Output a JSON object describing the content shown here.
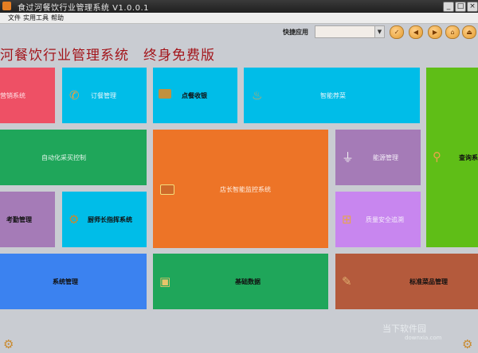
{
  "window": {
    "title": "食过河餐饮行业管理系统 V1.0.0.1"
  },
  "menu": [
    "文件",
    "实用工具",
    "帮助"
  ],
  "toolbar": {
    "quick_label": "快捷应用",
    "combo_value": ""
  },
  "banner": "河餐饮行业管理系统　终身免费版",
  "tiles": {
    "marketing": "营销系统",
    "order_mgmt": "订餐管理",
    "order_cash": "点餐收银",
    "smart_dish": "智能荐菜",
    "query": "查询系",
    "auto_purchase": "自动化采买控制",
    "store_monitor": "店长智能监控系统",
    "energy": "能源管理",
    "attendance": "考勤管理",
    "chef_command": "厨师长指挥系统",
    "quality_trace": "质量安全追溯",
    "system_mgmt": "系统管理",
    "base_data": "基础数据",
    "standard_dish": "标准菜品管理"
  },
  "watermark": {
    "main": "当下软件园",
    "sub": "downxia.com"
  },
  "colors": {
    "red": "#ee5065",
    "cyan": "#00bde8",
    "green": "#1fa65a",
    "orange": "#ed7427",
    "purple": "#a57bb7",
    "lightpurple": "#c886ef",
    "lime": "#5fbe17",
    "blue": "#3b82f0",
    "brown": "#b45a3c"
  }
}
